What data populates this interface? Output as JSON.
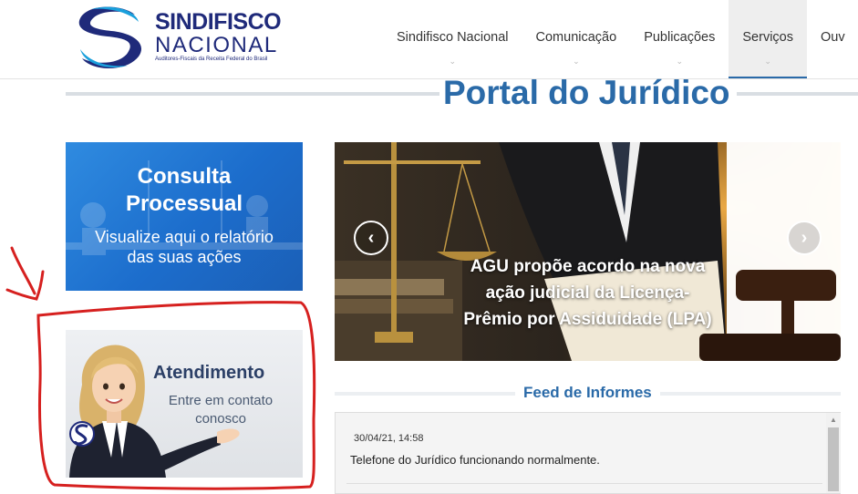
{
  "logo": {
    "line1": "SINDIFISCO",
    "line2": "NACIONAL",
    "tagline": "Auditores-Fiscais da Receita Federal do Brasil"
  },
  "nav": {
    "items": [
      {
        "label": "Sindifisco Nacional"
      },
      {
        "label": "Comunicação"
      },
      {
        "label": "Publicações"
      },
      {
        "label": "Serviços"
      },
      {
        "label": "Ouv"
      }
    ],
    "active": "Serviços"
  },
  "page": {
    "title": "Portal do Jurídico"
  },
  "consulta": {
    "title_line1": "Consulta",
    "title_line2": "Processual",
    "sub_line1": "Visualize aqui o relatório",
    "sub_line2": "das suas ações"
  },
  "atendimento": {
    "title": "Atendimento",
    "sub_line1": "Entre em contato",
    "sub_line2": "conosco"
  },
  "carousel": {
    "caption_line1": "AGU propõe acordo na nova",
    "caption_line2": "ação judicial da Licença-",
    "caption_line3": "Prêmio por Assiduidade (LPA)",
    "prev_icon": "chevron-left-icon",
    "next_icon": "chevron-right-icon"
  },
  "feed": {
    "title": "Feed de Informes",
    "items": [
      {
        "date": "30/04/21, 14:58",
        "text": "Telefone do Jurídico funcionando normalmente."
      }
    ]
  },
  "colors": {
    "brand_blue": "#2a6aa8",
    "logo_navy": "#1f2a7a",
    "consulta_blue": "#1c6dcc",
    "annotation_red": "#d6201f"
  }
}
